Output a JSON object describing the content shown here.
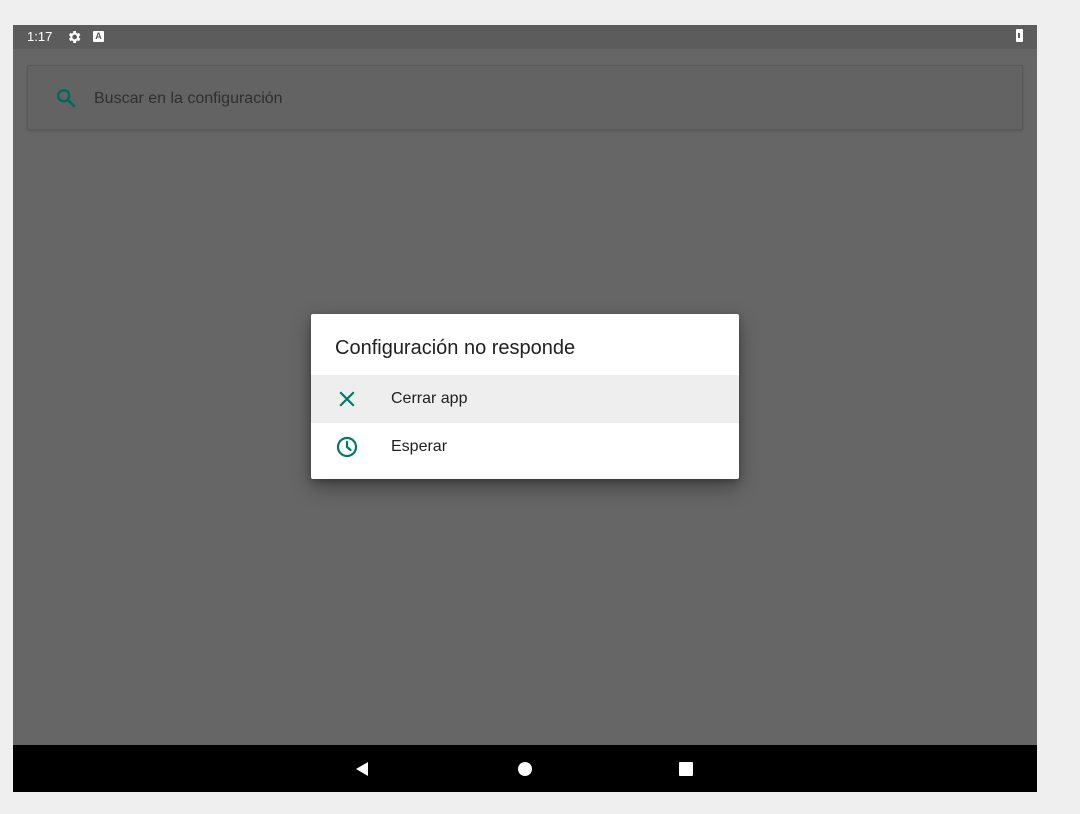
{
  "status_bar": {
    "time": "1:17",
    "gear_icon": "gear-icon",
    "notification_badge": "A",
    "battery_icon": "battery-icon"
  },
  "search": {
    "placeholder": "Buscar en la configuración",
    "icon": "search-icon",
    "accent_color": "#00695c"
  },
  "dialog": {
    "title": "Configuración no responde",
    "options": [
      {
        "label": "Cerrar app",
        "icon": "close-icon",
        "highlighted": true
      },
      {
        "label": "Esperar",
        "icon": "clock-icon",
        "highlighted": false
      }
    ],
    "icon_color": "#00796b"
  },
  "nav_bar": {
    "back_icon": "back-triangle-icon",
    "home_icon": "home-circle-icon",
    "recents_icon": "recents-square-icon"
  }
}
